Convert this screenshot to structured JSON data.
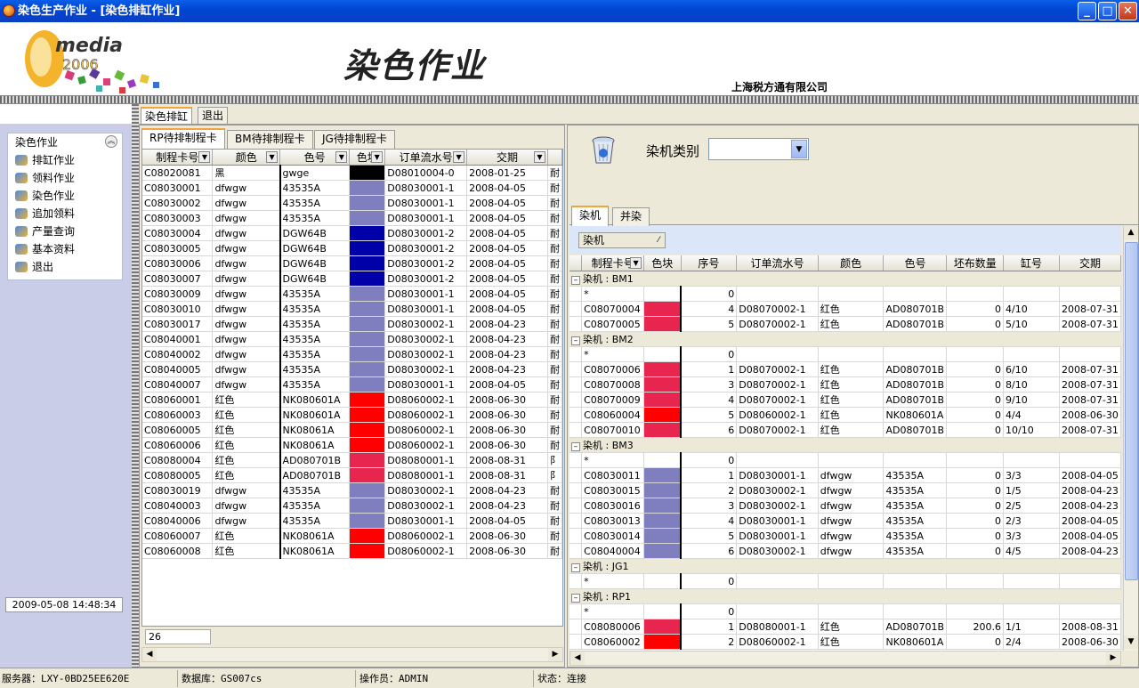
{
  "window": {
    "title": "染色生产作业 - [染色排缸作业]",
    "min": "_",
    "max": "□",
    "close": "✕"
  },
  "header": {
    "logo_text": "media",
    "logo_year": "2006",
    "title": "染色作业",
    "company": "上海税方通有限公司"
  },
  "tabs_main": [
    {
      "label": "染色排缸"
    },
    {
      "label": "退出"
    }
  ],
  "nav": {
    "header": "染色作业",
    "items": [
      {
        "label": "排缸作业"
      },
      {
        "label": "领料作业"
      },
      {
        "label": "染色作业"
      },
      {
        "label": "追加领料"
      },
      {
        "label": "产量查询"
      },
      {
        "label": "基本资料"
      },
      {
        "label": "退出"
      }
    ],
    "datetime": "2009-05-08 14:48:34"
  },
  "left_grid": {
    "tabs": [
      {
        "label": "RP待排制程卡"
      },
      {
        "label": "BM待排制程卡"
      },
      {
        "label": "JG待排制程卡"
      }
    ],
    "columns": [
      "制程卡号",
      "颜色",
      "色号",
      "色块",
      "订单流水号",
      "交期",
      ""
    ],
    "rows": [
      [
        "C08020081",
        "黑",
        "gwge",
        "#000000",
        "D08010004-0",
        "2008-01-25",
        "耐"
      ],
      [
        "C08030001",
        "dfwgw",
        "43535A",
        "#7f7fc0",
        "D08030001-1",
        "2008-04-05",
        "耐"
      ],
      [
        "C08030002",
        "dfwgw",
        "43535A",
        "#7f7fc0",
        "D08030001-1",
        "2008-04-05",
        "耐"
      ],
      [
        "C08030003",
        "dfwgw",
        "43535A",
        "#7f7fc0",
        "D08030001-1",
        "2008-04-05",
        "耐"
      ],
      [
        "C08030004",
        "dfwgw",
        "DGW64B",
        "#0000a8",
        "D08030001-2",
        "2008-04-05",
        "耐"
      ],
      [
        "C08030005",
        "dfwgw",
        "DGW64B",
        "#0000a8",
        "D08030001-2",
        "2008-04-05",
        "耐"
      ],
      [
        "C08030006",
        "dfwgw",
        "DGW64B",
        "#0000a8",
        "D08030001-2",
        "2008-04-05",
        "耐"
      ],
      [
        "C08030007",
        "dfwgw",
        "DGW64B",
        "#0000a8",
        "D08030001-2",
        "2008-04-05",
        "耐"
      ],
      [
        "C08030009",
        "dfwgw",
        "43535A",
        "#7f7fc0",
        "D08030001-1",
        "2008-04-05",
        "耐"
      ],
      [
        "C08030010",
        "dfwgw",
        "43535A",
        "#7f7fc0",
        "D08030001-1",
        "2008-04-05",
        "耐"
      ],
      [
        "C08030017",
        "dfwgw",
        "43535A",
        "#7f7fc0",
        "D08030002-1",
        "2008-04-23",
        "耐"
      ],
      [
        "C08040001",
        "dfwgw",
        "43535A",
        "#7f7fc0",
        "D08030002-1",
        "2008-04-23",
        "耐"
      ],
      [
        "C08040002",
        "dfwgw",
        "43535A",
        "#7f7fc0",
        "D08030002-1",
        "2008-04-23",
        "耐"
      ],
      [
        "C08040005",
        "dfwgw",
        "43535A",
        "#7f7fc0",
        "D08030002-1",
        "2008-04-23",
        "耐"
      ],
      [
        "C08040007",
        "dfwgw",
        "43535A",
        "#7f7fc0",
        "D08030001-1",
        "2008-04-05",
        "耐"
      ],
      [
        "C08060001",
        "红色",
        "NK080601A",
        "#ff0000",
        "D08060002-1",
        "2008-06-30",
        "耐"
      ],
      [
        "C08060003",
        "红色",
        "NK080601A",
        "#ff0000",
        "D08060002-1",
        "2008-06-30",
        "耐"
      ],
      [
        "C08060005",
        "红色",
        "NK08061A",
        "#ff0000",
        "D08060002-1",
        "2008-06-30",
        "耐"
      ],
      [
        "C08060006",
        "红色",
        "NK08061A",
        "#ff0000",
        "D08060002-1",
        "2008-06-30",
        "耐"
      ],
      [
        "C08080004",
        "红色",
        "AD080701B",
        "#e8254f",
        "D08080001-1",
        "2008-08-31",
        "阝"
      ],
      [
        "C08080005",
        "红色",
        "AD080701B",
        "#e8254f",
        "D08080001-1",
        "2008-08-31",
        "阝"
      ],
      [
        "C08030019",
        "dfwgw",
        "43535A",
        "#7f7fc0",
        "D08030002-1",
        "2008-04-23",
        "耐"
      ],
      [
        "C08040003",
        "dfwgw",
        "43535A",
        "#7f7fc0",
        "D08030002-1",
        "2008-04-23",
        "耐"
      ],
      [
        "C08040006",
        "dfwgw",
        "43535A",
        "#7f7fc0",
        "D08030001-1",
        "2008-04-05",
        "耐"
      ],
      [
        "C08060007",
        "红色",
        "NK08061A",
        "#ff0000",
        "D08060002-1",
        "2008-06-30",
        "耐"
      ],
      [
        "C08060008",
        "红色",
        "NK08061A",
        "#ff0000",
        "D08060002-1",
        "2008-06-30",
        "耐"
      ]
    ],
    "count": "26"
  },
  "right": {
    "dye_label": "染机类别",
    "dye_value": "",
    "tabs": [
      {
        "label": "染机"
      },
      {
        "label": "并染"
      }
    ],
    "group_chip": "染机",
    "columns": [
      "制程卡号",
      "色块",
      "序号",
      "订单流水号",
      "颜色",
      "色号",
      "坯布数量",
      "缸号",
      "交期"
    ],
    "groups": [
      {
        "label": "染机 : BM1",
        "rows": [
          [
            "C08070004",
            "#e8254f",
            "4",
            "D08070002-1",
            "红色",
            "AD080701B",
            "0",
            "4/10",
            "2008-07-31"
          ],
          [
            "C08070005",
            "#e8254f",
            "5",
            "D08070002-1",
            "红色",
            "AD080701B",
            "0",
            "5/10",
            "2008-07-31"
          ]
        ]
      },
      {
        "label": "染机 : BM2",
        "rows": [
          [
            "C08070006",
            "#e8254f",
            "1",
            "D08070002-1",
            "红色",
            "AD080701B",
            "0",
            "6/10",
            "2008-07-31"
          ],
          [
            "C08070008",
            "#e8254f",
            "3",
            "D08070002-1",
            "红色",
            "AD080701B",
            "0",
            "8/10",
            "2008-07-31"
          ],
          [
            "C08070009",
            "#e8254f",
            "4",
            "D08070002-1",
            "红色",
            "AD080701B",
            "0",
            "9/10",
            "2008-07-31"
          ],
          [
            "C08060004",
            "#ff0000",
            "5",
            "D08060002-1",
            "红色",
            "NK080601A",
            "0",
            "4/4",
            "2008-06-30"
          ],
          [
            "C08070010",
            "#e8254f",
            "6",
            "D08070002-1",
            "红色",
            "AD080701B",
            "0",
            "10/10",
            "2008-07-31"
          ]
        ]
      },
      {
        "label": "染机 : BM3",
        "rows": [
          [
            "C08030011",
            "#7f7fc0",
            "1",
            "D08030001-1",
            "dfwgw",
            "43535A",
            "0",
            "3/3",
            "2008-04-05"
          ],
          [
            "C08030015",
            "#7f7fc0",
            "2",
            "D08030002-1",
            "dfwgw",
            "43535A",
            "0",
            "1/5",
            "2008-04-23"
          ],
          [
            "C08030016",
            "#7f7fc0",
            "3",
            "D08030002-1",
            "dfwgw",
            "43535A",
            "0",
            "2/5",
            "2008-04-23"
          ],
          [
            "C08030013",
            "#7f7fc0",
            "4",
            "D08030001-1",
            "dfwgw",
            "43535A",
            "0",
            "2/3",
            "2008-04-05"
          ],
          [
            "C08030014",
            "#7f7fc0",
            "5",
            "D08030001-1",
            "dfwgw",
            "43535A",
            "0",
            "3/3",
            "2008-04-05"
          ],
          [
            "C08040004",
            "#7f7fc0",
            "6",
            "D08030002-1",
            "dfwgw",
            "43535A",
            "0",
            "4/5",
            "2008-04-23"
          ]
        ]
      },
      {
        "label": "染机 : JG1",
        "rows": []
      },
      {
        "label": "染机 : RP1",
        "rows": [
          [
            "C08080006",
            "#e8254f",
            "1",
            "D08080001-1",
            "红色",
            "AD080701B",
            "200.6",
            "1/1",
            "2008-08-31"
          ],
          [
            "C08060002",
            "#ff0000",
            "2",
            "D08060002-1",
            "红色",
            "NK080601A",
            "0",
            "2/4",
            "2008-06-30"
          ]
        ]
      }
    ],
    "new_row_mark": "*",
    "new_row_zero": "0",
    "collapse_mark": "–"
  },
  "status": {
    "server": "服务器：LXY-0BD25EE620E",
    "database": "数据库：GS007cs",
    "operator": "操作员：ADMIN",
    "state": "状态：连接"
  }
}
